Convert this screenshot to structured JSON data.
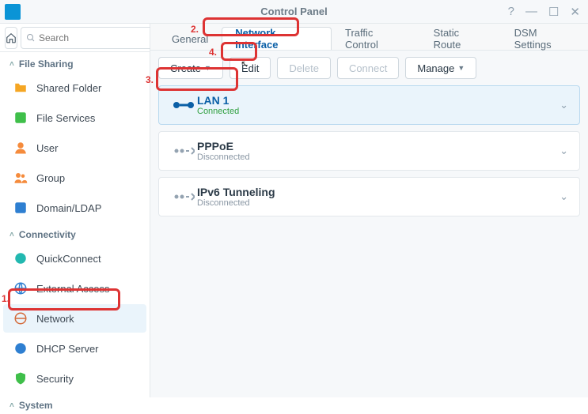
{
  "window": {
    "title": "Control Panel"
  },
  "search": {
    "placeholder": "Search"
  },
  "sidebar": {
    "sections": [
      {
        "label": "File Sharing",
        "items": [
          {
            "label": "Shared Folder"
          },
          {
            "label": "File Services"
          },
          {
            "label": "User"
          },
          {
            "label": "Group"
          },
          {
            "label": "Domain/LDAP"
          }
        ]
      },
      {
        "label": "Connectivity",
        "items": [
          {
            "label": "QuickConnect"
          },
          {
            "label": "External Access"
          },
          {
            "label": "Network"
          },
          {
            "label": "DHCP Server"
          },
          {
            "label": "Security"
          }
        ]
      },
      {
        "label": "System",
        "items": []
      }
    ]
  },
  "tabs": [
    {
      "label": "General"
    },
    {
      "label": "Network Interface"
    },
    {
      "label": "Traffic Control"
    },
    {
      "label": "Static Route"
    },
    {
      "label": "DSM Settings"
    }
  ],
  "toolbar": {
    "create": "Create",
    "edit": "Edit",
    "delete": "Delete",
    "connect": "Connect",
    "manage": "Manage"
  },
  "interfaces": [
    {
      "name": "LAN 1",
      "status": "Connected"
    },
    {
      "name": "PPPoE",
      "status": "Disconnected"
    },
    {
      "name": "IPv6 Tunneling",
      "status": "Disconnected"
    }
  ],
  "annotations": {
    "1": "1.",
    "2": "2.",
    "3": "3.",
    "4": "4."
  }
}
